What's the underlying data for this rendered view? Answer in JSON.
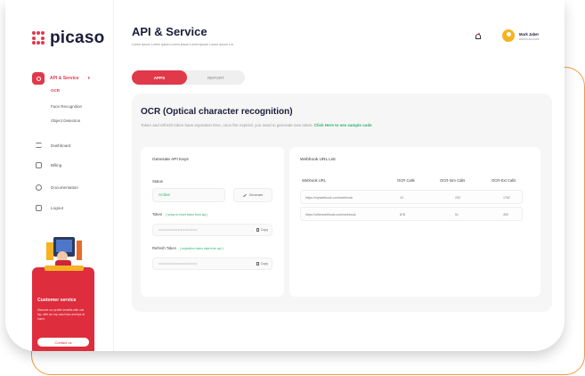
{
  "brand": {
    "name": "picaso",
    "accent": "#e0394a",
    "frame": "#f29b3a",
    "success": "#2ab26b"
  },
  "sidebar": {
    "api_service": {
      "label": "API & Service",
      "icon": "api-icon",
      "caret": "chevron-down-icon"
    },
    "subitems": [
      "OCR",
      "Face Recognition",
      "Object Detection"
    ],
    "items": [
      {
        "label": "Dashboard",
        "icon": "dashboard-icon"
      },
      {
        "label": "Billing",
        "icon": "billing-icon"
      },
      {
        "label": "Documentation",
        "icon": "documentation-icon"
      },
      {
        "label": "Logout",
        "icon": "logout-icon"
      }
    ],
    "promo": {
      "title": "Customer service",
      "desc": "Discover our profile benefits with one tap, with our top-notch tips and tips at home.",
      "button": "Contact us"
    }
  },
  "header": {
    "title": "API & Service",
    "subtitle": "Lorem ipsum Lorem ipsum Lorem ipsum Lorem ipsum Lorem ipsum Lor",
    "user": {
      "name": "Mark Jaber",
      "role": "Admin account"
    }
  },
  "tabs": [
    "APPS",
    "REPORT"
  ],
  "ocr": {
    "title": "OCR (Optical character recognition)",
    "note": "Token and refresh token have expiration time, once the expired, you need to generate new token.",
    "link": "Click Here to see sample code"
  },
  "keys": {
    "title": "Generate API Keys",
    "status_label": "Status",
    "status_value": "Active",
    "generate": "Generate",
    "token_label": "Token",
    "token_hint": "( setup to reset token from api )",
    "token_value": "••••••••••••••••••••••••••••",
    "refresh_label": "Refresh Token",
    "refresh_hint": "( expiration token date from api )",
    "refresh_value": "••••••••••••••••••••••••••••",
    "copy": "Copy"
  },
  "webhook": {
    "title": "Webhook URL List",
    "columns": [
      "Webhook URL",
      "OCR Calls",
      "OCR-Sim Calls",
      "OCR-Ext Calls"
    ],
    "rows": [
      [
        "https://mywebhook.com/webhook",
        "12",
        "232",
        "1762"
      ],
      [
        "https://otherwebhook.com/webhook",
        "878",
        "51",
        "490"
      ]
    ]
  }
}
